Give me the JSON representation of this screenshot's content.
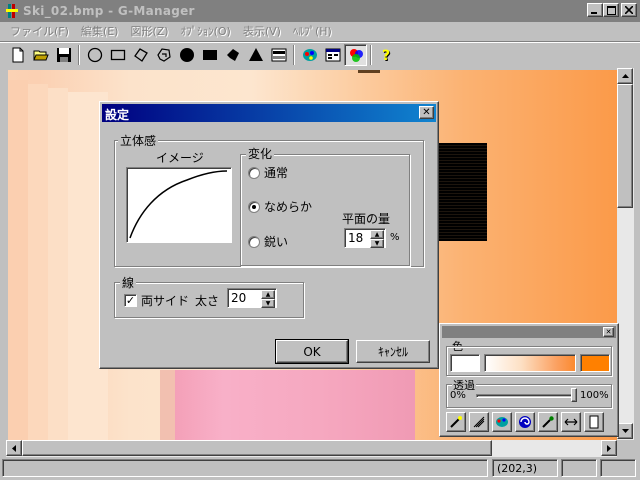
{
  "window": {
    "title": "Ski_02.bmp - G-Manager"
  },
  "menu": [
    "ファイル(F)",
    "編集(E)",
    "図形(Z)",
    "ｵﾌﾟｼｮﾝ(O)",
    "表示(V)",
    "ﾍﾙﾌﾟ(H)"
  ],
  "toolbar": {
    "icons": [
      "new-file-icon",
      "open-folder-icon",
      "save-disk-icon",
      "circle-outline-icon",
      "rectangle-outline-icon",
      "polygon-outline-icon",
      "freeform-outline-icon",
      "circle-filled-icon",
      "rectangle-filled-icon",
      "polygon-filled-icon",
      "triangle-filled-icon",
      "gradient-bar-icon",
      "color-palette-icon",
      "properties-icon",
      "solid-3d-icon",
      "help-icon"
    ]
  },
  "dialog": {
    "title": "設定",
    "close_glyph": "✕",
    "solid": {
      "label": "立体感",
      "image_label": "イメージ",
      "change": {
        "label": "変化",
        "options": [
          {
            "label": "通常",
            "selected": false
          },
          {
            "label": "なめらか",
            "selected": true
          },
          {
            "label": "鋭い",
            "selected": false
          }
        ],
        "amount_label": "平面の量",
        "amount_value": "18",
        "amount_unit": "%"
      }
    },
    "line": {
      "label": "線",
      "both_sides_label": "両サイド",
      "both_sides_checked": true,
      "check_glyph": "✓",
      "thickness_label": "太さ",
      "thickness_value": "20"
    },
    "ok_label": "OK",
    "cancel_label": "ｷｬﾝｾﾙ"
  },
  "palette": {
    "close_glyph": "✕",
    "color_label": "色",
    "alpha_label": "透過",
    "alpha_min": "0%",
    "alpha_max": "100%",
    "alpha_value": 1.0,
    "colors": {
      "start": "#ffffff",
      "end": "#ff8000"
    }
  },
  "status": {
    "coords": "(202,3)"
  },
  "colors": {
    "title_inactive": "#808080",
    "dialog_title_start": "#000080",
    "dialog_title_end": "#1084d0"
  }
}
